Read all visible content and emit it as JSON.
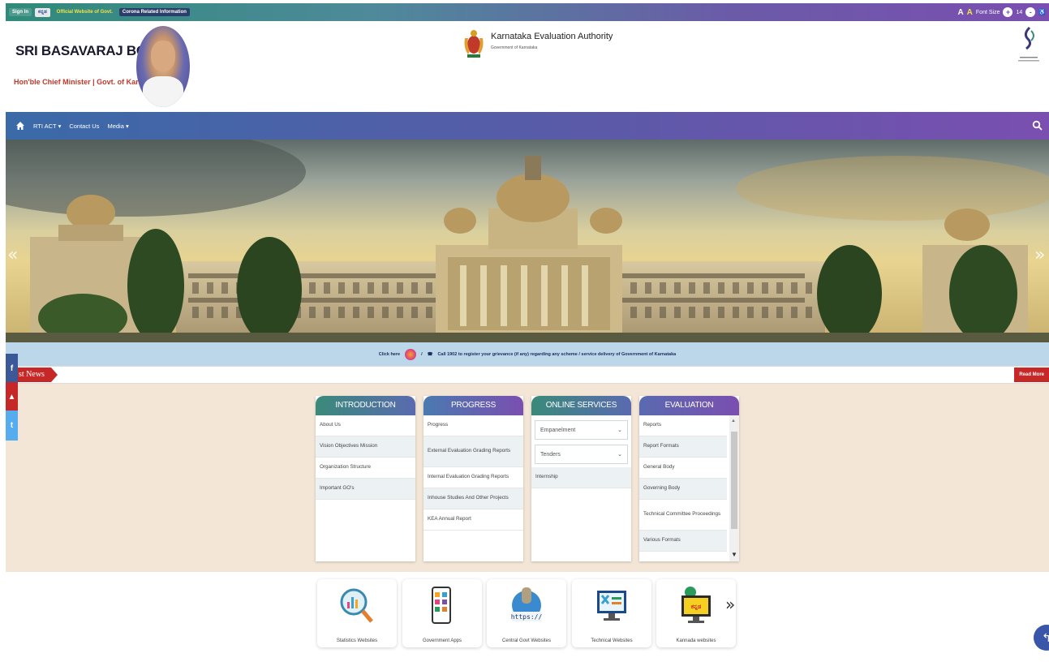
{
  "topbar": {
    "signin": "Sign In",
    "kannada": "ಕನ್ನಡ",
    "official": "Official Website of Govt.",
    "corona": "Corona Related Information",
    "a_small": "A",
    "a_large": "A",
    "font_size": "Font Size",
    "plus": "+",
    "size": "14",
    "minus": "-"
  },
  "header": {
    "cm_name": "SRI BASAVARAJ BOMMAI",
    "cm_title": "Hon'ble Chief Minister | Govt. of Karnataka",
    "kea_title": "Karnataka Evaluation Authority",
    "kea_sub": "Government of Karnataka"
  },
  "nav": {
    "items": [
      "RTI ACT ▾",
      "Contact Us",
      "Media ▾"
    ]
  },
  "grievance": {
    "click": "Click here",
    "slash": "/",
    "call": "Call 1902 to register your grievance (if any) regarding any scheme / service delivery of Government of Karnataka"
  },
  "news": {
    "label": "st News",
    "read_more": "Read More"
  },
  "social": {
    "fb": "f",
    "yt": "▲",
    "tw": "t"
  },
  "cards": {
    "introduction": {
      "title": "INTRODUCTION",
      "items": [
        "About Us",
        "Vision Objectives Mission",
        "Organization Structure",
        "Important GO's"
      ]
    },
    "progress": {
      "title": "PROGRESS",
      "items": [
        "Progress",
        "External Evaluation Grading Reports",
        "Internal Evaluation Grading Reports",
        "Inhouse Studies And Other Projects",
        "KEA Annual Report"
      ]
    },
    "online": {
      "title": "ONLINE SERVICES",
      "dropdowns": [
        "Empanelment",
        "Tenders"
      ],
      "items": [
        "Internship"
      ]
    },
    "evaluation": {
      "title": "EVALUATION",
      "items": [
        "Reports",
        "Report Formats",
        "General Body",
        "Governing Body",
        "Technical Committee Proceedings",
        "Various Formats"
      ]
    }
  },
  "carousel": {
    "prev": "«",
    "next": "»",
    "tiles": [
      "Statistics Websites",
      "Government Apps",
      "Central Govt Websites",
      "Technical Websites",
      "Kannada websites"
    ],
    "https_text": "https://",
    "kannada_tile_text": "ಕನ್ನಡ"
  },
  "banner": {
    "prev": "«",
    "next": "»"
  },
  "colors": {
    "accent_purple": "#7a4fb0",
    "accent_teal": "#2f8a7a",
    "news_red": "#c62828",
    "panel_beige": "#f3e6d6"
  }
}
